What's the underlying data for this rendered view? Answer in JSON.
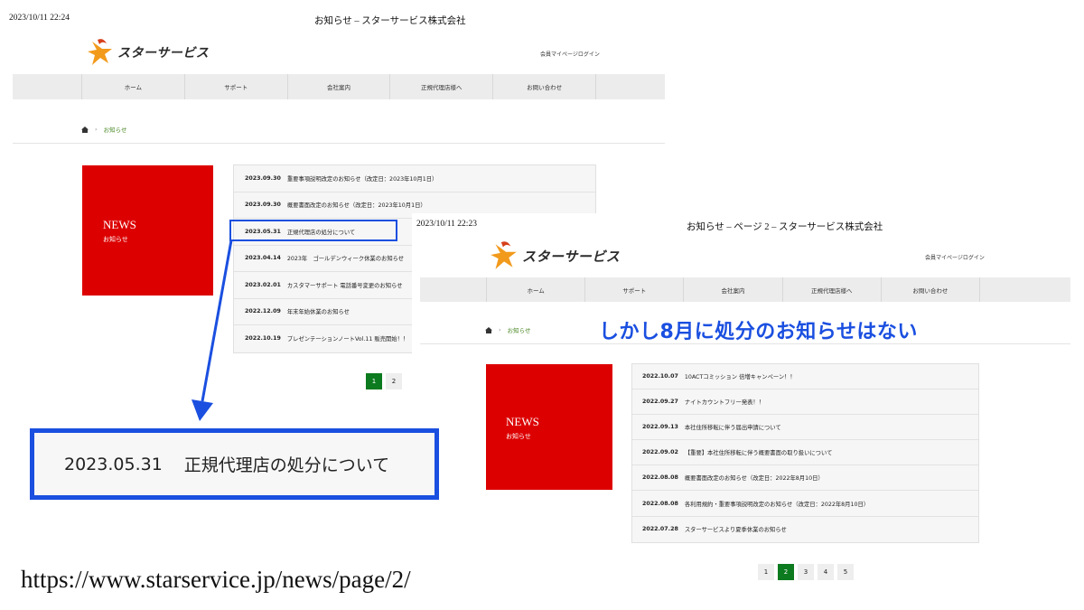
{
  "left": {
    "timestamp": "2023/10/11 22:24",
    "page_title": "お知らせ – スターサービス株式会社",
    "logo_text": "スターサービス",
    "login_link": "会員マイページログイン",
    "nav": [
      "ホーム",
      "サポート",
      "会社案内",
      "正規代理店様へ",
      "お問い合わせ"
    ],
    "breadcrumb": "お知らせ",
    "news_title": "NEWS",
    "news_subtitle": "お知らせ",
    "items": [
      {
        "date": "2023.09.30",
        "title": "重要事項説明改定のお知らせ（改定日：2023年10月1日）"
      },
      {
        "date": "2023.09.30",
        "title": "概要書面改定のお知らせ（改定日：2023年10月1日）"
      },
      {
        "date": "2023.05.31",
        "title": "正規代理店の処分について"
      },
      {
        "date": "2023.04.14",
        "title": "2023年　ゴールデンウィーク休業のお知らせ"
      },
      {
        "date": "2023.02.01",
        "title": "カスタマーサポート 電話番号変更のお知らせ"
      },
      {
        "date": "2022.12.09",
        "title": "年末年始休業のお知らせ"
      },
      {
        "date": "2022.10.19",
        "title": "プレゼンテーションノートVol.11 販売開始！！"
      }
    ],
    "pagination": [
      "1",
      "2"
    ]
  },
  "zoom": {
    "date": "2023.05.31",
    "title": "正規代理店の処分について"
  },
  "url_caption": "https://www.starservice.jp/news/page/2/",
  "right": {
    "timestamp": "2023/10/11 22:23",
    "page_title": "お知らせ – ページ 2 – スターサービス株式会社",
    "logo_text": "スターサービス",
    "login_link": "会員マイページログイン",
    "nav": [
      "ホーム",
      "サポート",
      "会社案内",
      "正規代理店様へ",
      "お問い合わせ"
    ],
    "breadcrumb": "お知らせ",
    "news_title": "NEWS",
    "news_subtitle": "お知らせ",
    "items": [
      {
        "date": "2022.10.07",
        "title": "10ACTコミッション 倍増キャンペーン！！"
      },
      {
        "date": "2022.09.27",
        "title": "ナイトカウントフリー発表！！"
      },
      {
        "date": "2022.09.13",
        "title": "本社住所移転に伴う届出申請について"
      },
      {
        "date": "2022.09.02",
        "title": "【重要】本社住所移転に伴う概要書面の取り扱いについて"
      },
      {
        "date": "2022.08.08",
        "title": "概要書面改定のお知らせ（改定日：2022年8月10日）"
      },
      {
        "date": "2022.08.08",
        "title": "各利用規約・重要事項説明改定のお知らせ（改定日：2022年8月10日）"
      },
      {
        "date": "2022.07.28",
        "title": "スターサービスより夏季休業のお知らせ"
      }
    ],
    "pagination": [
      "1",
      "2",
      "3",
      "4",
      "5"
    ]
  },
  "annotation_text": "しかし8月に処分のお知らせはない",
  "colors": {
    "annotation_blue": "#1a4fe0",
    "news_red": "#dd0000",
    "active_green": "#0c7a1e",
    "crumb_green": "#4c8a28"
  }
}
